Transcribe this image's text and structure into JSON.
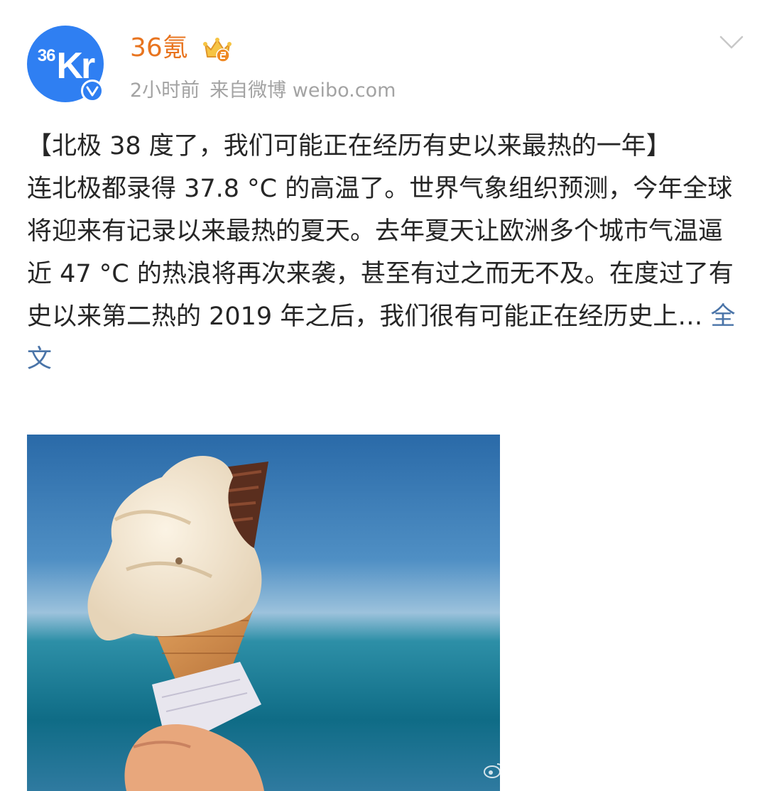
{
  "account": {
    "avatar_text_small": "36",
    "avatar_text_big": "Kr",
    "name": "36氪",
    "time": "2小时前",
    "source": "来自微博 weibo.com"
  },
  "icons": {
    "verified": "verified-badge-icon",
    "crown": "vip-crown-icon",
    "menu": "chevron-down-icon",
    "watermark": "weibo-logo-icon"
  },
  "colors": {
    "accent_name": "#e8741f",
    "link": "#4a74a8",
    "avatar_bg": "#2f7ff2",
    "meta": "#a3a3a3"
  },
  "post": {
    "title": "【北极 38 度了，我们可能正在经历有史以来最热的一年】",
    "body": "连北极都录得 37.8 °C 的高温了。世界气象组织预测，今年全球将迎来有记录以来最热的夏天。去年夏天让欧洲多个城市气温逼近 47 °C 的热浪将再次来袭，甚至有过之而无不及。在度过了有史以来第二热的 2019 年之后，我们很有可能正在经历史上… ",
    "more_link": "全文"
  }
}
